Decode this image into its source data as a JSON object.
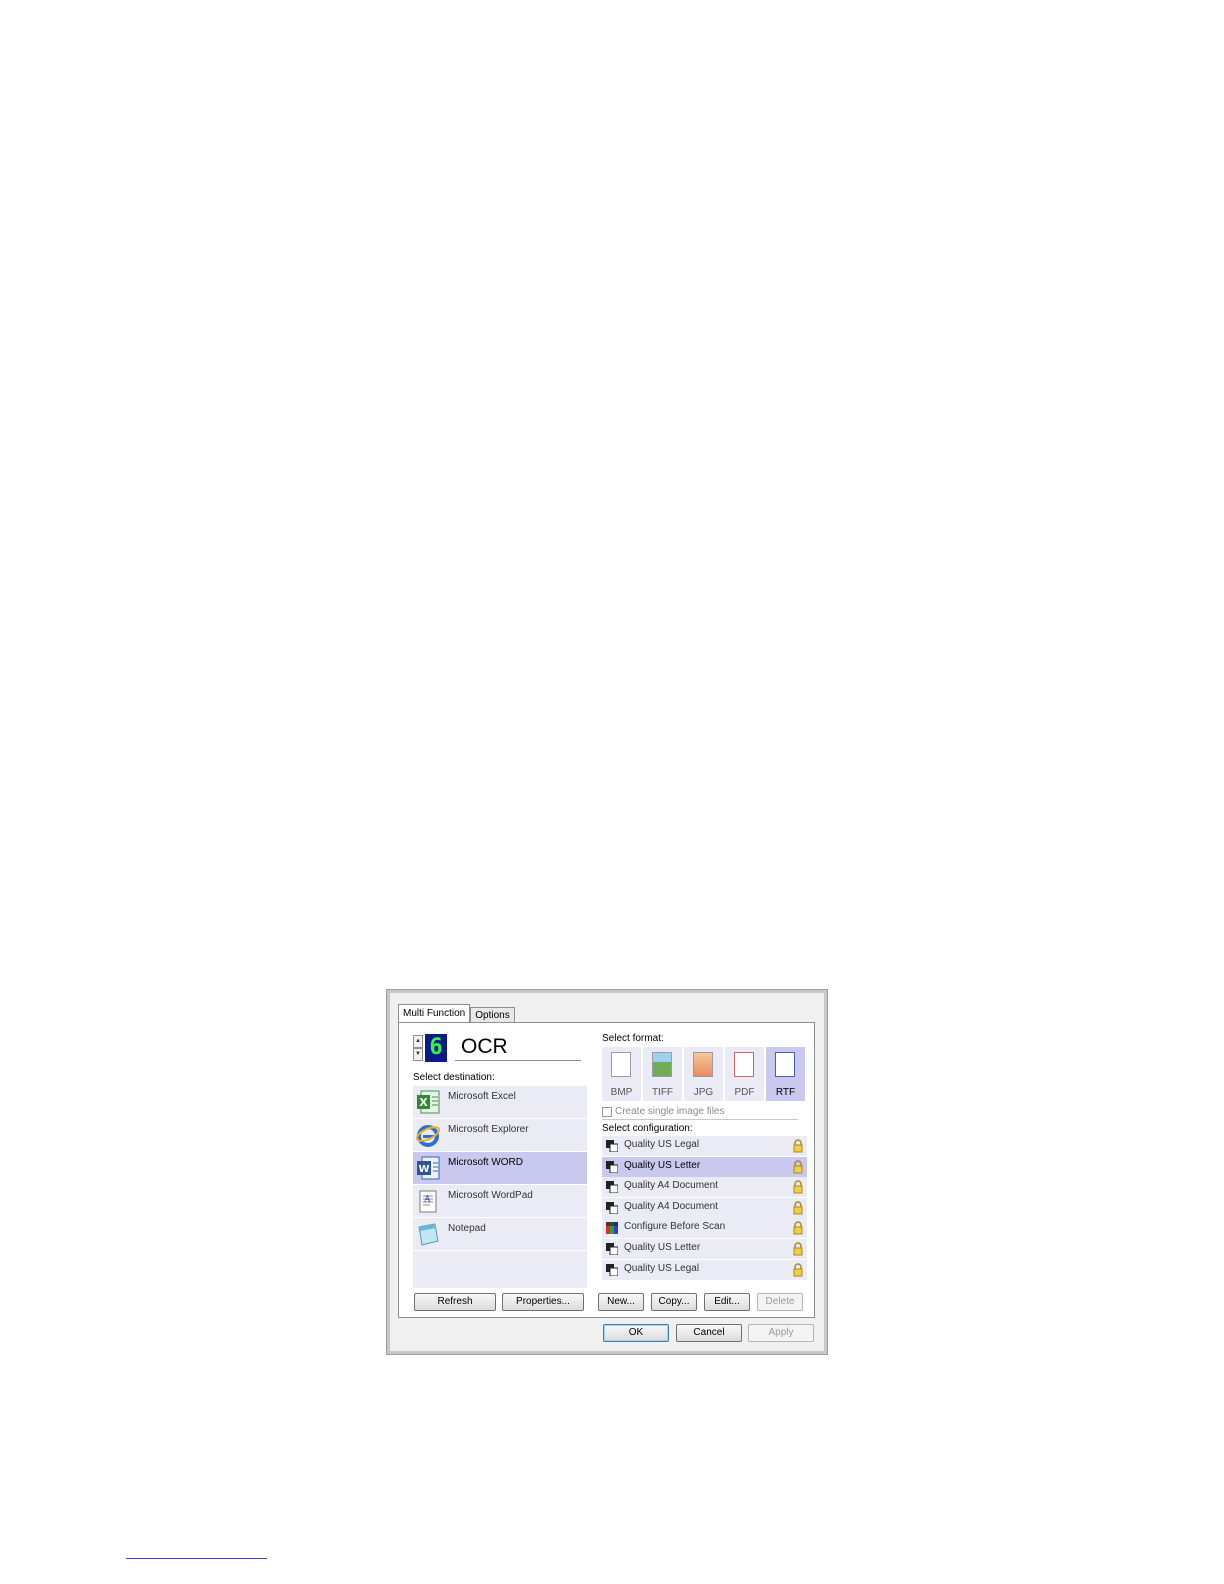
{
  "dialog": {
    "tabs": [
      {
        "label": "Multi Function",
        "active": true
      },
      {
        "label": "Options",
        "active": false
      }
    ],
    "button_number": "6",
    "button_name": "OCR",
    "select_destination_label": "Select destination:",
    "destinations": [
      {
        "name": "Microsoft Excel",
        "icon": "excel-icon",
        "selected": false
      },
      {
        "name": "Microsoft Explorer",
        "icon": "internet-explorer-icon",
        "selected": false
      },
      {
        "name": "Microsoft WORD",
        "icon": "word-icon",
        "selected": true
      },
      {
        "name": "Microsoft WordPad",
        "icon": "wordpad-icon",
        "selected": false
      },
      {
        "name": "Notepad",
        "icon": "notepad-icon",
        "selected": false
      }
    ],
    "select_format_label": "Select format:",
    "formats": [
      {
        "label": "BMP",
        "selected": false
      },
      {
        "label": "TIFF",
        "selected": false
      },
      {
        "label": "JPG",
        "selected": false
      },
      {
        "label": "PDF",
        "selected": false
      },
      {
        "label": "RTF",
        "selected": true
      }
    ],
    "create_single_image_files_label": "Create single image files",
    "create_single_image_files_checked": false,
    "select_configuration_label": "Select configuration:",
    "configurations": [
      {
        "name": "Quality US Legal",
        "selected": false,
        "icon": "bw-scan-icon"
      },
      {
        "name": "Quality US Letter",
        "selected": true,
        "icon": "bw-scan-icon"
      },
      {
        "name": "Quality A4 Document",
        "selected": false,
        "icon": "bw-scan-icon"
      },
      {
        "name": "Quality A4 Document",
        "selected": false,
        "icon": "bw-scan-icon"
      },
      {
        "name": "Configure Before Scan",
        "selected": false,
        "icon": "color-scan-icon"
      },
      {
        "name": "Quality US Letter",
        "selected": false,
        "icon": "bw-scan-icon"
      },
      {
        "name": "Quality US Legal",
        "selected": false,
        "icon": "bw-scan-icon"
      }
    ],
    "buttons": {
      "refresh": "Refresh",
      "properties": "Properties...",
      "new": "New...",
      "copy": "Copy...",
      "edit": "Edit...",
      "delete": "Delete",
      "ok": "OK",
      "cancel": "Cancel",
      "apply": "Apply"
    },
    "colors": {
      "selected_row": "#c9c9f0",
      "row": "#ebebf6",
      "lcd_bg": "#0a1a8c",
      "lcd_digit": "#2cff3a"
    }
  }
}
